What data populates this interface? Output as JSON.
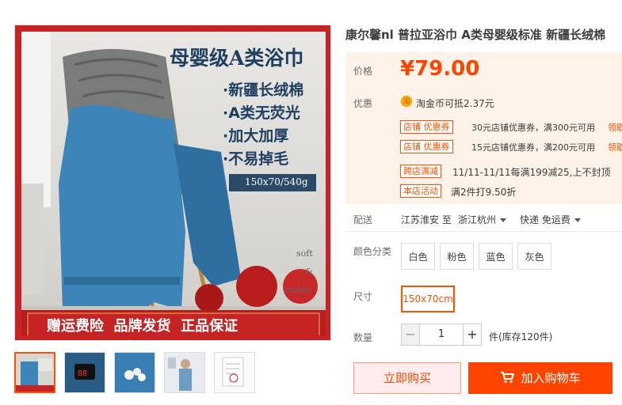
{
  "product": {
    "title": "康尔馨nl 普拉亚浴巾 A类母婴级标准 新疆长绒棉",
    "image": {
      "headline": "母婴级A类浴巾",
      "bullets": [
        "·新疆长绒棉",
        "·A类无荧光",
        "·加大加厚",
        "·不易掉毛"
      ],
      "spec": "150x70/540g",
      "side_text_1": "soft",
      "side_text_2": "&",
      "side_text_3": "rtable",
      "banner": "赠运费险  品牌发货  正品保证"
    },
    "thumbnails": [
      "thumb-1",
      "thumb-2",
      "thumb-3",
      "thumb-4",
      "thumb-5"
    ]
  },
  "price": {
    "label": "价格",
    "value": "¥79.00"
  },
  "promo": {
    "label": "优惠",
    "coin_icon": "淘",
    "coin_text": "淘金币可抵2.37元",
    "coupons": [
      {
        "tag": "店铺 优惠券",
        "text": "30元店铺优惠券，满300元可用",
        "get": "领取"
      },
      {
        "tag": "店铺 优惠券",
        "text": "15元店铺优惠券，满200元可用",
        "get": "领取"
      }
    ],
    "events": [
      {
        "tag": "跨店满减",
        "text": "11/11-11/11每满199减25,上不封顶"
      },
      {
        "tag": "本店活动",
        "text": "满2件打9.50折"
      }
    ]
  },
  "shipping": {
    "label": "配送",
    "from": "江苏淮安 至",
    "to": "浙江杭州",
    "method": "快递 免运费"
  },
  "color": {
    "label": "颜色分类",
    "options": [
      "白色",
      "粉色",
      "蓝色",
      "灰色"
    ]
  },
  "size": {
    "label": "尺寸",
    "options": [
      "150x70cm"
    ]
  },
  "quantity": {
    "label": "数量",
    "minus": "−",
    "value": "1",
    "plus": "+",
    "stock": "件(库存120件)"
  },
  "actions": {
    "buy": "立即购买",
    "cart": "加入购物车"
  },
  "colors": {
    "accent": "#ff4400",
    "price_bg": "#fff2e8"
  }
}
